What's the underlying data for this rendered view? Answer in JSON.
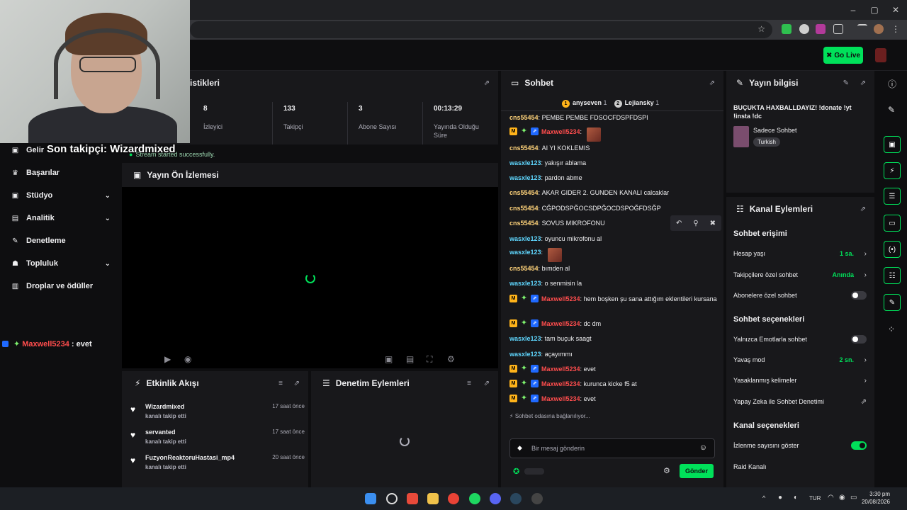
{
  "browser": {
    "win_minimize": "–",
    "win_maximize": "▢",
    "win_close": "✕"
  },
  "topnav": {
    "go_live": "Go Live"
  },
  "webcam": {
    "follower_overlay": "Son takipçi: Wizardmixed"
  },
  "sidebar": {
    "items": [
      {
        "label": "Gelir",
        "icon": "money-icon",
        "has_chevron": false
      },
      {
        "label": "Başarılar",
        "icon": "trophy-icon",
        "has_chevron": false
      },
      {
        "label": "Stüdyo",
        "icon": "video-icon",
        "has_chevron": true
      },
      {
        "label": "Analitik",
        "icon": "chart-icon",
        "has_chevron": true
      },
      {
        "label": "Denetleme",
        "icon": "wrench-icon",
        "has_chevron": false
      },
      {
        "label": "Topluluk",
        "icon": "users-icon",
        "has_chevron": true
      },
      {
        "label": "Droplar ve ödüller",
        "icon": "gift-icon",
        "has_chevron": false
      }
    ],
    "overlay_chat_user": "Maxwell5234",
    "overlay_chat_text": " : evet"
  },
  "stats": {
    "title": "tistikleri",
    "toast": "Stream started successfully.",
    "items": [
      {
        "value": "8",
        "label": "İzleyici"
      },
      {
        "value": "133",
        "label": "Takipçi"
      },
      {
        "value": "3",
        "label": "Abone Sayısı"
      },
      {
        "value": "00:13:29",
        "label": "Yayında Olduğu Süre"
      }
    ]
  },
  "preview": {
    "title": "Yayın Ön İzlemesi"
  },
  "activity": {
    "title": "Etkinlik Akışı",
    "events": [
      {
        "name": "Wizardmixed",
        "action": "kanalı takip etti",
        "time": "17 saat önce"
      },
      {
        "name": "servanted",
        "action": "kanalı takip etti",
        "time": "17 saat önce"
      },
      {
        "name": "FuzyonReaktoruHastasi_mp4",
        "action": "kanalı takip etti",
        "time": "20 saat önce"
      }
    ]
  },
  "moderation": {
    "title": "Denetim Eylemleri"
  },
  "chat": {
    "title": "Sohbet",
    "leaderboard": [
      {
        "rank": "1",
        "name": "anyseven",
        "count": "1"
      },
      {
        "rank": "2",
        "name": "Lejiansky",
        "count": "1"
      }
    ],
    "messages": [
      {
        "user": "cns55454",
        "cls": "u-cns",
        "badges": false,
        "text": "PEMBE PEMBE FDSOCFDSPFDSPI",
        "emote": false
      },
      {
        "user": "Maxwell5234",
        "cls": "u-max",
        "badges": true,
        "text": "",
        "emote": true
      },
      {
        "user": "cns55454",
        "cls": "u-cns",
        "badges": false,
        "text": "AI YI KOKLEMIS",
        "emote": false
      },
      {
        "user": "wasxle123",
        "cls": "u-was",
        "badges": false,
        "text": "yakışır ablama",
        "emote": false
      },
      {
        "user": "wasxle123",
        "cls": "u-was",
        "badges": false,
        "text": "pardon abme",
        "emote": false
      },
      {
        "user": "cns55454",
        "cls": "u-cns",
        "badges": false,
        "text": "AKAR GIDER 2. GUNDEN KANALI calcaklar",
        "emote": false
      },
      {
        "user": "cns55454",
        "cls": "u-cns",
        "badges": false,
        "text": "CĞPODSPĞOCSDPĞOCDSPOĞFDSĞP",
        "emote": false
      },
      {
        "user": "cns55454",
        "cls": "u-cns",
        "badges": false,
        "text": "SOVUS MIKROFONU",
        "emote": false
      },
      {
        "user": "wasxle123",
        "cls": "u-was",
        "badges": false,
        "text": "oyuncu mikrofonu al",
        "emote": false
      },
      {
        "user": "wasxle123",
        "cls": "u-was",
        "badges": false,
        "text": "",
        "emote": true
      },
      {
        "user": "cns55454",
        "cls": "u-cns",
        "badges": false,
        "text": "bımden al",
        "emote": false
      },
      {
        "user": "wasxle123",
        "cls": "u-was",
        "badges": false,
        "text": "o senmisin la",
        "emote": false
      },
      {
        "user": "Maxwell5234",
        "cls": "u-max",
        "badges": true,
        "text": "hem boşken şu sana attığım eklentileri kursana",
        "emote": false
      },
      {
        "user": "Maxwell5234",
        "cls": "u-max",
        "badges": true,
        "text": "dc dm",
        "emote": false
      },
      {
        "user": "wasxle123",
        "cls": "u-was",
        "badges": false,
        "text": "tam buçuk saagt",
        "emote": false
      },
      {
        "user": "wasxle123",
        "cls": "u-was",
        "badges": false,
        "text": "açayımmı",
        "emote": false
      },
      {
        "user": "Maxwell5234",
        "cls": "u-max",
        "badges": true,
        "text": "evet",
        "emote": false
      },
      {
        "user": "Maxwell5234",
        "cls": "u-max",
        "badges": true,
        "text": "kurunca kicke f5 at",
        "emote": false
      },
      {
        "user": "Maxwell5234",
        "cls": "u-max",
        "badges": true,
        "text": "evet",
        "emote": false
      }
    ],
    "connecting": "Sohbet odasına bağlanılıyor...",
    "input_placeholder": "Bir mesaj gönderin",
    "send_label": "Gönder"
  },
  "stream_info": {
    "title": "Yayın bilgisi",
    "stream_title": "BUÇUKTA HAXBALLDAYIZ! !donate !yt !insta !dc",
    "category": "Sadece Sohbet",
    "tag": "Turkish"
  },
  "channel_actions": {
    "title": "Kanal Eylemleri",
    "chat_access_header": "Sohbet erişimi",
    "account_age_label": "Hesap yaşı",
    "account_age_value": "1 sa.",
    "followers_only_label": "Takipçilere özel sohbet",
    "followers_only_value": "Anında",
    "subs_only_label": "Abonelere özel sohbet",
    "chat_options_header": "Sohbet seçenekleri",
    "emote_only_label": "Yalnızca Emotlarla sohbet",
    "slow_mode_label": "Yavaş mod",
    "slow_mode_value": "2 sn.",
    "banned_words_label": "Yasaklanmış kelimeler",
    "ai_moderation_label": "Yapay Zeka ile Sohbet Denetimi",
    "channel_options_header": "Kanal seçenekleri",
    "show_viewcount_label": "İzlenme sayısını göster",
    "raid_label": "Raid Kanalı"
  },
  "taskbar": {
    "lang": "TUR",
    "time": "3:30 pm",
    "date": "20/08/2026"
  },
  "colors": {
    "accent": "#00e15a",
    "panel": "#18181b",
    "bg": "#0e0e10"
  }
}
